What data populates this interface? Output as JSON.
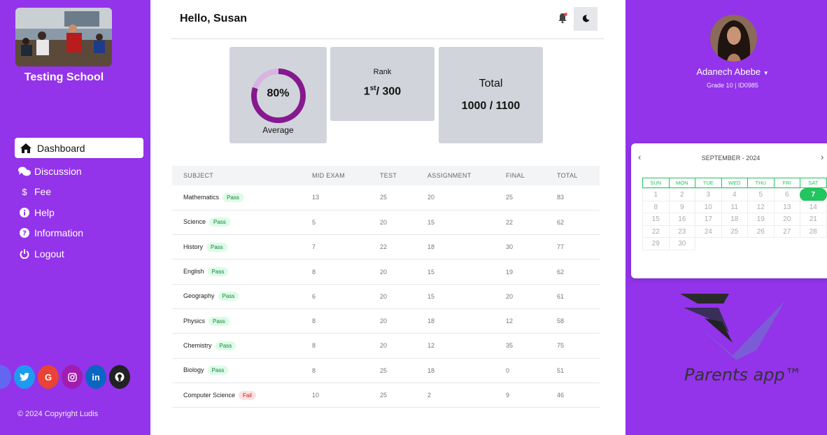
{
  "sidebar": {
    "school_name": "Testing School",
    "nav": [
      {
        "label": "Dashboard",
        "icon": "home-icon",
        "active": true
      },
      {
        "label": "Discussion",
        "icon": "chat-icon"
      },
      {
        "label": "Fee",
        "icon": "dollar-icon"
      },
      {
        "label": "Help",
        "icon": "info-icon"
      },
      {
        "label": "Information",
        "icon": "question-icon"
      },
      {
        "label": "Logout",
        "icon": "power-icon"
      }
    ],
    "socials": [
      {
        "name": "twitter-icon",
        "color": "#1d9bf0"
      },
      {
        "name": "google-icon",
        "color": "#ea4335"
      },
      {
        "name": "instagram-icon",
        "color": "#a21caf"
      },
      {
        "name": "linkedin-icon",
        "color": "#0a66c2"
      },
      {
        "name": "github-icon",
        "color": "#222222"
      }
    ],
    "copyright": "© 2024 Copyright Ludis"
  },
  "header": {
    "greeting": "Hello, Susan"
  },
  "stats": {
    "average_value": "80%",
    "average_fraction": 0.8,
    "average_label": "Average",
    "rank_label": "Rank",
    "rank_position": "1",
    "rank_suffix": "st",
    "rank_of": "/ 300",
    "total_label": "Total",
    "total_value": "1000 / 1100"
  },
  "grades": {
    "columns": [
      "SUBJECT",
      "MID EXAM",
      "TEST",
      "ASSIGNMENT",
      "FINAL",
      "TOTAL"
    ],
    "rows": [
      {
        "subject": "Mathematics",
        "status": "Pass",
        "mid": "13",
        "test": "25",
        "assignment": "20",
        "final": "25",
        "total": "83"
      },
      {
        "subject": "Science",
        "status": "Pass",
        "mid": "5",
        "test": "20",
        "assignment": "15",
        "final": "22",
        "total": "62"
      },
      {
        "subject": "History",
        "status": "Pass",
        "mid": "7",
        "test": "22",
        "assignment": "18",
        "final": "30",
        "total": "77"
      },
      {
        "subject": "English",
        "status": "Pass",
        "mid": "8",
        "test": "20",
        "assignment": "15",
        "final": "19",
        "total": "62"
      },
      {
        "subject": "Geography",
        "status": "Pass",
        "mid": "6",
        "test": "20",
        "assignment": "15",
        "final": "20",
        "total": "61"
      },
      {
        "subject": "Physics",
        "status": "Pass",
        "mid": "8",
        "test": "20",
        "assignment": "18",
        "final": "12",
        "total": "58"
      },
      {
        "subject": "Chemistry",
        "status": "Pass",
        "mid": "8",
        "test": "20",
        "assignment": "12",
        "final": "35",
        "total": "75"
      },
      {
        "subject": "Biology",
        "status": "Pass",
        "mid": "8",
        "test": "25",
        "assignment": "18",
        "final": "0",
        "total": "51"
      },
      {
        "subject": "Computer Science",
        "status": "Fail",
        "mid": "10",
        "test": "25",
        "assignment": "2",
        "final": "9",
        "total": "46"
      }
    ]
  },
  "profile": {
    "name": "Adanech Abebe",
    "meta": "Grade 10 | ID0985"
  },
  "calendar": {
    "month_label": "SEPTEMBER - 2024",
    "weekdays": [
      "SUN",
      "MON",
      "TUE",
      "WED",
      "THU",
      "FRI",
      "SAT"
    ],
    "days": [
      "1",
      "2",
      "3",
      "4",
      "5",
      "6",
      "7",
      "8",
      "9",
      "10",
      "11",
      "12",
      "13",
      "14",
      "15",
      "16",
      "17",
      "18",
      "19",
      "20",
      "21",
      "22",
      "23",
      "24",
      "25",
      "26",
      "27",
      "28",
      "29",
      "30"
    ],
    "selected_day": "7"
  },
  "brand": {
    "app_name": "Parents app™"
  },
  "colors": {
    "sidebar_bg": "#9333ea",
    "donut_fill": "#86198f",
    "donut_track": "#d8b4e2",
    "calendar_accent": "#22c55e"
  }
}
